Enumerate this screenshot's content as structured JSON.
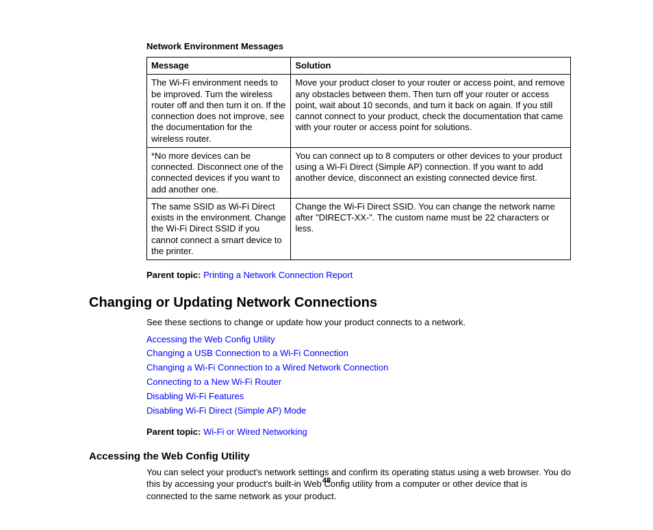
{
  "tableTitle": "Network Environment Messages",
  "headers": {
    "message": "Message",
    "solution": "Solution"
  },
  "rows": [
    {
      "message": "The Wi-Fi environment needs to be improved. Turn the wireless router off and then turn it on. If the connection does not improve, see the documentation for the wireless router.",
      "solution": "Move your product closer to your router or access point, and remove any obstacles between them. Then turn off your router or access point, wait about 10 seconds, and turn it back on again. If you still cannot connect to your product, check the documentation that came with your router or access point for solutions."
    },
    {
      "message": "*No more devices can be connected. Disconnect one of the connected devices if you want to add another one.",
      "solution": "You can connect up to 8 computers or other devices to your product using a Wi-Fi Direct (Simple AP) connection. If you want to add another device, disconnect an existing connected device first."
    },
    {
      "message": "The same SSID as Wi-Fi Direct exists in the environment. Change the Wi-Fi Direct SSID if you cannot connect a smart device to the printer.",
      "solution": "Change the Wi-Fi Direct SSID. You can change the network name after \"DIRECT-XX-\". The custom name must be 22 characters or less."
    }
  ],
  "parentTopic1": {
    "label": "Parent topic:",
    "link": "Printing a Network Connection Report"
  },
  "sectionTitle": "Changing or Updating Network Connections",
  "sectionIntro": "See these sections to change or update how your product connects to a network.",
  "links": [
    "Accessing the Web Config Utility",
    "Changing a USB Connection to a Wi-Fi Connection",
    "Changing a Wi-Fi Connection to a Wired Network Connection",
    "Connecting to a New Wi-Fi Router",
    "Disabling Wi-Fi Features",
    "Disabling Wi-Fi Direct (Simple AP) Mode"
  ],
  "parentTopic2": {
    "label": "Parent topic:",
    "link": "Wi-Fi or Wired Networking"
  },
  "subsectionTitle": "Accessing the Web Config Utility",
  "subsectionBody": "You can select your product's network settings and confirm its operating status using a web browser. You do this by accessing your product's built-in Web Config utility from a computer or other device that is connected to the same network as your product.",
  "pageNumber": "48"
}
